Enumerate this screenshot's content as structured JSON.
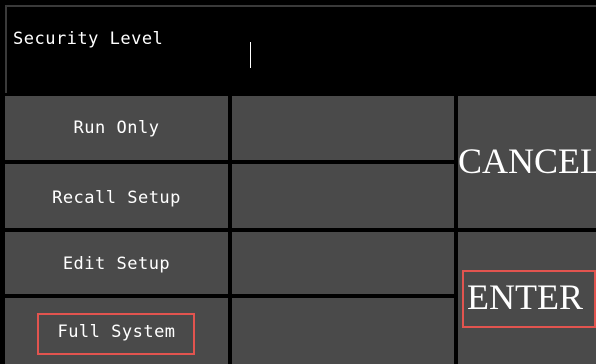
{
  "header": {
    "label": "Security Level",
    "input_value": ""
  },
  "levels": [
    {
      "label": "Run Only"
    },
    {
      "label": "Recall Setup"
    },
    {
      "label": "Edit Setup"
    },
    {
      "label": "Full System",
      "highlighted": true
    }
  ],
  "actions": {
    "cancel_label": "CANCEL",
    "enter_label": "ENTER"
  },
  "colors": {
    "background": "#000000",
    "button": "#4a4a4a",
    "text": "#ffffff",
    "highlight": "#e2544f"
  }
}
